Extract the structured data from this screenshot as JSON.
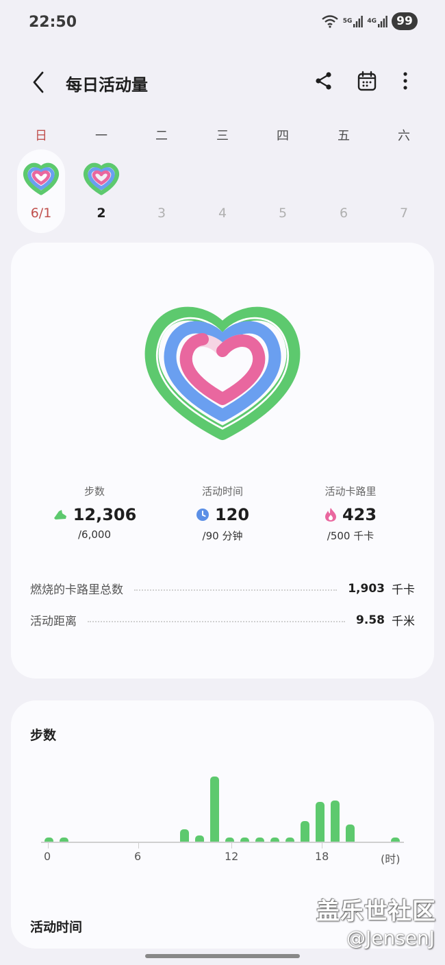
{
  "status_bar": {
    "time": "22:50",
    "net1": "5G",
    "net2": "4G",
    "battery": "99"
  },
  "header": {
    "title": "每日活动量"
  },
  "week": {
    "weekdays": [
      "日",
      "一",
      "二",
      "三",
      "四",
      "五",
      "六"
    ],
    "dates": [
      "6/1",
      "2",
      "3",
      "4",
      "5",
      "6",
      "7"
    ]
  },
  "stats": {
    "steps": {
      "label": "步数",
      "value": "12,306",
      "goal": "/6,000"
    },
    "active_time": {
      "label": "活动时间",
      "value": "120",
      "goal": "/90 分钟"
    },
    "calories": {
      "label": "活动卡路里",
      "value": "423",
      "goal": "/500 千卡"
    }
  },
  "summary": {
    "total_calories": {
      "label": "燃烧的卡路里总数",
      "value": "1,903",
      "unit": "千卡"
    },
    "distance": {
      "label": "活动距离",
      "value": "9.58",
      "unit": "千米"
    }
  },
  "steps_chart": {
    "title": "步数",
    "x_labels": [
      "0",
      "6",
      "12",
      "18",
      "(时)"
    ]
  },
  "chart_data": {
    "type": "bar",
    "title": "步数",
    "xlabel": "(时)",
    "x_ticks": [
      0,
      6,
      12,
      18
    ],
    "categories": [
      0,
      1,
      9,
      10,
      11,
      12,
      13,
      14,
      15,
      16,
      17,
      18,
      19,
      20,
      23
    ],
    "values": [
      60,
      60,
      180,
      90,
      950,
      60,
      60,
      60,
      60,
      60,
      300,
      580,
      600,
      250,
      60
    ],
    "ymax": 1000
  },
  "next_section": {
    "title": "活动时间"
  },
  "watermark": {
    "line1": "盖乐世社区",
    "line2": "@JensenJ"
  },
  "colors": {
    "green": "#5dc96e",
    "blue": "#6a9ff0",
    "pink": "#e9679f",
    "sunday_red": "#c0504d"
  }
}
